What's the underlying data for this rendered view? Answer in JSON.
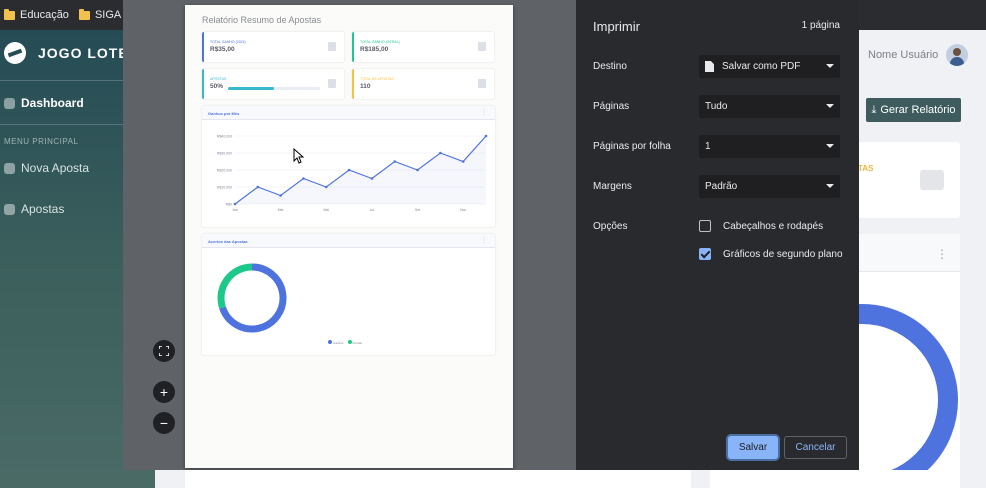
{
  "bookmarks": [
    {
      "label": "Educação"
    },
    {
      "label": "SIGA"
    }
  ],
  "app": {
    "brand": "JOGO LOTERI",
    "sidebar": {
      "dashboard": "Dashboard",
      "section": "MENU PRINCIPAL",
      "items": [
        "Nova Aposta",
        "Apostas"
      ]
    },
    "user": "Nome Usuário",
    "generate_button": "Gerar Relatório",
    "card_fragment": "TAS"
  },
  "preview": {
    "report_title": "Relatório Resumo de Apostas",
    "cards": [
      {
        "label": "TOTAL GANHO (2024)",
        "value": "R$35,00",
        "color": "#4e73df"
      },
      {
        "label": "TOTAL GANHO (GERAL)",
        "value": "R$185,00",
        "color": "#1cc88a"
      },
      {
        "label": "APOSTAS",
        "value": "50%",
        "color": "#36b9cc",
        "progress": 0.5
      },
      {
        "label": "TOTAL DE APOSTAS",
        "value": "110",
        "color": "#f6c23e"
      }
    ],
    "earnings_panel": "Ganhos por Mês",
    "hits_panel": "Acertos das Apostas",
    "legend": [
      "Ganhos",
      "Perdas"
    ]
  },
  "chart_data": [
    {
      "type": "line",
      "title": "Ganhos por Mês",
      "categories": [
        "Jan",
        "Mar",
        "Mai",
        "Jul",
        "Set",
        "Nov"
      ],
      "y_ticks": [
        "R$0",
        "R$10,000",
        "R$20,000",
        "R$30,000",
        "R$40,000"
      ],
      "ylim": [
        0,
        40000
      ],
      "values": [
        0,
        10000,
        5000,
        15000,
        10000,
        20000,
        15000,
        25000,
        20000,
        30000,
        25000,
        40000
      ],
      "color": "#4e73df"
    },
    {
      "type": "pie",
      "title": "Acertos das Apostas",
      "labels": [
        "Ganhos",
        "Perdas"
      ],
      "values": [
        70,
        30
      ],
      "colors": [
        "#4e73df",
        "#1cc88a"
      ]
    }
  ],
  "print_dialog": {
    "title": "Imprimir",
    "page_count": "1 página",
    "destination_label": "Destino",
    "destination_value": "Salvar como PDF",
    "pages_label": "Páginas",
    "pages_value": "Tudo",
    "pages_per_sheet_label": "Páginas por folha",
    "pages_per_sheet_value": "1",
    "margins_label": "Margens",
    "margins_value": "Padrão",
    "options_label": "Opções",
    "option_headers": "Cabeçalhos e rodapés",
    "option_headers_checked": false,
    "option_background": "Gráficos de segundo plano",
    "option_background_checked": true,
    "save_button": "Salvar",
    "cancel_button": "Cancelar"
  }
}
